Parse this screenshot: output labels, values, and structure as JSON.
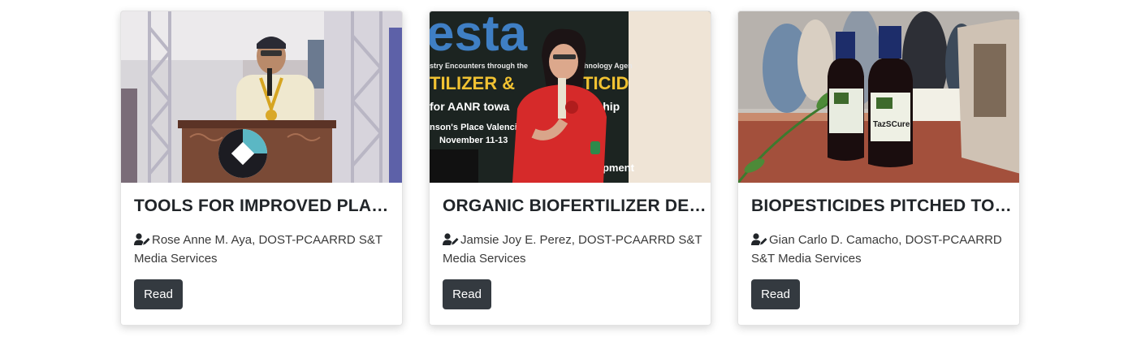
{
  "cards": [
    {
      "title": "TOOLS FOR IMPROVED PLANT …",
      "author": "Rose Anne M. Aya, DOST-PCAARRD S&T Media Services",
      "button_label": "Read"
    },
    {
      "title": "ORGANIC BIOFERTILIZER DEV…",
      "author": "Jamsie Joy E. Perez, DOST-PCAARRD S&T Media Services",
      "button_label": "Read",
      "photo_text": {
        "banner_top": "esta",
        "banner_line1": "stry Encounters through the",
        "banner_line1b": "chnology Agen",
        "banner_line2": "TILIZER &",
        "banner_line2b": "TICID",
        "banner_line3": "for AANR towa",
        "banner_line3b": "rship",
        "banner_line4": "nson's Place Valenci",
        "banner_line5": "November 11-13",
        "banner_line6": "opment"
      }
    },
    {
      "title": "BIOPESTICIDES PITCHED TO P…",
      "author": "Gian Carlo D. Camacho, DOST-PCAARRD S&T Media Services",
      "button_label": "Read",
      "photo_text": {
        "label": "TazSCure"
      }
    }
  ],
  "colors": {
    "button_bg": "#343a40",
    "title_text": "#212529"
  }
}
